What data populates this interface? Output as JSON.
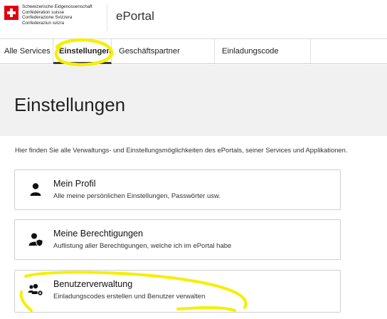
{
  "header": {
    "confederation_lines": [
      "Schweizerische Eidgenossenschaft",
      "Confédération suisse",
      "Confederazione Svizzera",
      "Confederaziun svizra"
    ],
    "app_title": "ePortal"
  },
  "nav": {
    "tabs": [
      {
        "label": "Alle Services"
      },
      {
        "label": "Einstellungen",
        "active": true
      },
      {
        "label": "Geschäftspartner verwalten"
      },
      {
        "label": "Einladungscode einlösen"
      }
    ]
  },
  "main": {
    "title": "Einstellungen",
    "intro": "Hier finden Sie alle Verwaltungs- und Einstellungsmöglichkeiten des ePortals, seiner Services und Applikationen.",
    "cards": [
      {
        "title": "Mein Profil",
        "description": "Alle meine persönlichen Einstellungen, Passwörter usw.",
        "icon": "user-icon"
      },
      {
        "title": "Meine Berechtigungen",
        "description": "Auflistung aller Berechtigungen, welche ich im ePortal habe",
        "icon": "user-shield-icon"
      },
      {
        "title": "Benutzerverwaltung",
        "description": "Einladungscodes erstellen und Benutzer verwalten",
        "icon": "users-gear-icon"
      }
    ]
  },
  "colors": {
    "swiss_red": "#e3000f",
    "annotation_yellow": "#f5ef00",
    "title_band": "#f1f1f1"
  }
}
